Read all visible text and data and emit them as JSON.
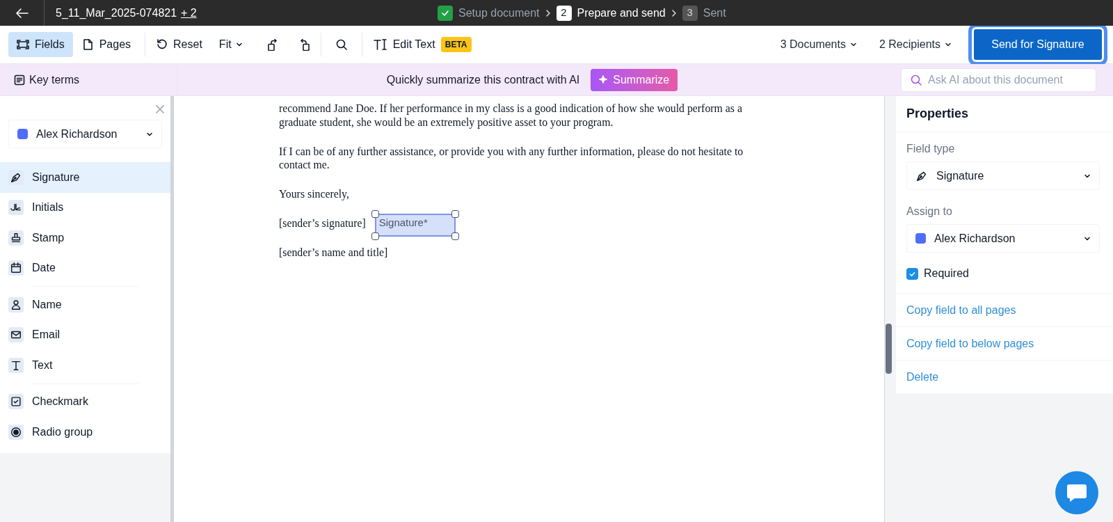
{
  "header": {
    "file_name": "5_11_Mar_2025-074821",
    "extra_count": "+ 2",
    "steps": [
      {
        "label": "Setup document",
        "done": true,
        "selected": false
      },
      {
        "number": "2",
        "label": "Prepare and send",
        "done": false,
        "selected": true
      },
      {
        "number": "3",
        "label": "Sent",
        "done": false,
        "selected": false
      }
    ]
  },
  "toolbar": {
    "view_tabs": [
      {
        "label": "Fields",
        "selected": true
      },
      {
        "label": "Pages",
        "selected": false
      }
    ],
    "reset": "Reset",
    "fit": "Fit",
    "edit_text": {
      "label": "Edit Text",
      "badge": "BETA"
    },
    "documents": "3 Documents",
    "recipients": "2 Recipients",
    "send_button": "Send for Signature"
  },
  "ai_bar": {
    "key_terms": "Key terms",
    "prompt": "Quickly summarize this contract with AI",
    "summarize": "Summarize",
    "search": {
      "placeholder": "Ask AI about this document"
    }
  },
  "sidebar": {
    "recipient": {
      "name": "Alex Richardson",
      "color": "#4f6ef7"
    },
    "groups": [
      [
        {
          "kind": "signature",
          "label": "Signature",
          "selected": true
        },
        {
          "kind": "initials",
          "label": "Initials",
          "selected": false
        },
        {
          "kind": "stamp",
          "label": "Stamp",
          "selected": false
        },
        {
          "kind": "date",
          "label": "Date",
          "selected": false
        }
      ],
      [
        {
          "kind": "name",
          "label": "Name",
          "selected": false
        },
        {
          "kind": "email",
          "label": "Email",
          "selected": false
        },
        {
          "kind": "text",
          "label": "Text",
          "selected": false
        }
      ],
      [
        {
          "kind": "checkmark",
          "label": "Checkmark",
          "selected": false
        },
        {
          "kind": "radio",
          "label": "Radio group",
          "selected": false
        }
      ]
    ]
  },
  "document": {
    "paragraphs": [
      "recommend Jane Doe. If her performance in my class is a good indication of how she would perform as a graduate student, she would be an extremely positive asset to your program.",
      "If I can be of any further assistance, or provide you with any further information, please do not hesitate to contact me.",
      "Yours sincerely,"
    ],
    "signature_line": "[sender’s signature]",
    "placed_field": {
      "label": "Signature*",
      "selected": true
    },
    "name_line": "[sender’s name and title]"
  },
  "properties": {
    "title": "Properties",
    "field_type_label": "Field type",
    "field_type": "Signature",
    "assign_label": "Assign to",
    "assignee": {
      "name": "Alex Richardson",
      "color": "#4f6ef7"
    },
    "required": {
      "label": "Required",
      "checked": true
    },
    "actions": [
      "Copy field to all pages",
      "Copy field to below pages",
      "Delete"
    ]
  }
}
